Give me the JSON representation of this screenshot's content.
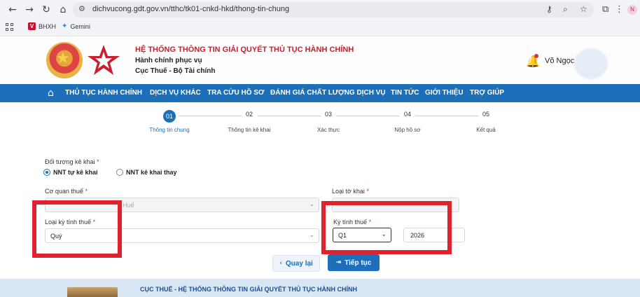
{
  "browser": {
    "url": "dichvucong.gdt.gov.vn/tthc/tk01-cnkd-hkd/thong-tin-chung",
    "bookmarks": [
      {
        "label": "BHXH",
        "icon": "v-badge-icon"
      },
      {
        "label": "Gemini",
        "icon": "gemini-icon"
      }
    ],
    "profile_initial": "N"
  },
  "header": {
    "title": "HỆ THỐNG THÔNG TIN GIẢI QUYẾT THỦ TỤC HÀNH CHÍNH",
    "subtitle": "Hành chính phục vụ",
    "agency": "Cục Thuế - Bộ Tài chính",
    "user_name": "Võ Ngọc H"
  },
  "nav": {
    "items": [
      "THỦ TỤC HÀNH CHÍNH",
      "DỊCH VỤ KHÁC",
      "TRA CỨU HỒ SƠ",
      "ĐÁNH GIÁ CHẤT LƯỢNG DỊCH VỤ",
      "TIN TỨC",
      "GIỚI THIỆU",
      "TRỢ GIÚP"
    ]
  },
  "stepper": {
    "active_index": 0,
    "steps": [
      {
        "num": "01",
        "label": "Thông tin chung"
      },
      {
        "num": "02",
        "label": "Thông tin kê khai"
      },
      {
        "num": "03",
        "label": "Xác thực"
      },
      {
        "num": "04",
        "label": "Nộp hồ sơ"
      },
      {
        "num": "05",
        "label": "Kết quả"
      }
    ]
  },
  "form": {
    "doi_tuong_label": "Đối tượng kê khai",
    "radio_self": "NNT tự kê khai",
    "radio_other": "NNT kê khai thay",
    "co_quan_thue_label": "Cơ quan thuế",
    "co_quan_thue_value": "Huế",
    "loai_to_khai_label": "Loại tờ khai",
    "loai_ky_label": "Loại kỳ tính thuế",
    "loai_ky_value": "Quý",
    "ky_tinh_thue_label": "Kỳ tính thuế",
    "ky_quy_value": "Q1",
    "ky_nam_value": "2026",
    "required_mark": "*"
  },
  "buttons": {
    "back": "Quay lại",
    "next": "Tiếp tục"
  },
  "footer": {
    "text": "CỤC THUẾ - HỆ THỐNG THÔNG TIN GIẢI QUYẾT THỦ TỤC HÀNH CHÍNH"
  },
  "colors": {
    "primary": "#1c6fb8",
    "brand_red": "#c8202f",
    "highlight_red": "#e0222d"
  }
}
